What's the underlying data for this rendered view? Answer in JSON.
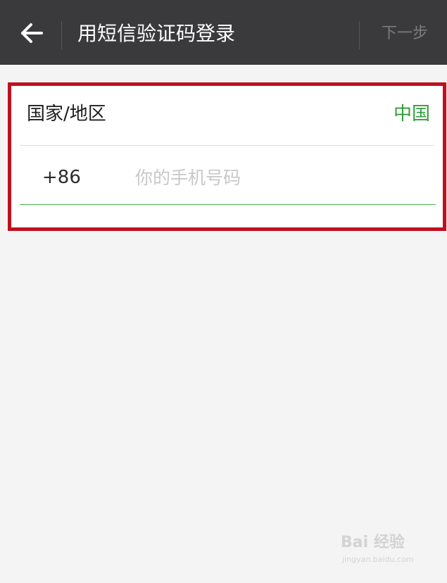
{
  "header": {
    "title": "用短信验证码登录",
    "next_label": "下一步",
    "back_icon": "arrow-left-icon"
  },
  "form": {
    "region_label": "国家/地区",
    "region_value": "中国",
    "country_code": "+86",
    "phone_placeholder": "你的手机号码",
    "phone_value": ""
  },
  "watermark": {
    "brand": "Bai 经验",
    "url": "jingyan.baidu.com"
  },
  "colors": {
    "header_bg": "#3a3a3c",
    "accent_green": "#2d9e3b",
    "highlight_red": "#c0101e",
    "content_bg": "#f4f4f5"
  }
}
